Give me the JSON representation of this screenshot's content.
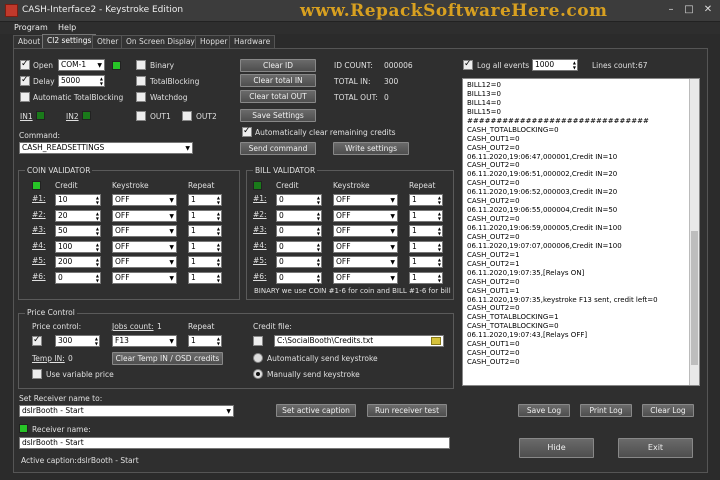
{
  "window": {
    "title": "CASH-Interface2 - Keystroke Edition",
    "watermark": "www.RepackSoftwareHere.com",
    "min": "–",
    "max": "□",
    "close": "✕"
  },
  "menu": [
    "Program",
    "Help"
  ],
  "tabs": [
    "About",
    "Cl2 settings",
    "Other",
    "On Screen Display",
    "Hopper",
    "Hardware"
  ],
  "top": {
    "open_label": "Open",
    "port": "COM-1",
    "delay_label": "Delay",
    "delay_value": "5000",
    "auto_totalblocking": "Automatic TotalBlocking",
    "binary": "Binary",
    "totalblocking": "TotalBlocking",
    "watchdog": "Watchdog",
    "in1": "IN1",
    "in2": "IN2",
    "out1": "OUT1",
    "out2": "OUT2",
    "clear_id": "Clear ID",
    "clear_total_in": "Clear total IN",
    "clear_total_out": "Clear total OUT",
    "save_settings": "Save Settings",
    "id_count_label": "ID COUNT:",
    "id_count": "000006",
    "total_in_label": "TOTAL IN:",
    "total_in": "300",
    "total_out_label": "TOTAL OUT:",
    "total_out": "0",
    "auto_clear": "Automatically clear remaining credits",
    "command_label": "Command:",
    "command_value": "CASH_READSETTINGS",
    "send_command": "Send command",
    "write_settings": "Write settings"
  },
  "coin": {
    "title": "COIN VALIDATOR",
    "headers": [
      "Credit",
      "Keystroke",
      "Repeat"
    ],
    "rows": [
      {
        "id": "#1:",
        "credit": "10",
        "key": "OFF",
        "repeat": "1"
      },
      {
        "id": "#2:",
        "credit": "20",
        "key": "OFF",
        "repeat": "1"
      },
      {
        "id": "#3:",
        "credit": "50",
        "key": "OFF",
        "repeat": "1"
      },
      {
        "id": "#4:",
        "credit": "100",
        "key": "OFF",
        "repeat": "1"
      },
      {
        "id": "#5:",
        "credit": "200",
        "key": "OFF",
        "repeat": "1"
      },
      {
        "id": "#6:",
        "credit": "0",
        "key": "OFF",
        "repeat": "1"
      }
    ]
  },
  "bill": {
    "title": "BILL VALIDATOR",
    "headers": [
      "Credit",
      "Keystroke",
      "Repeat"
    ],
    "rows": [
      {
        "id": "#1:",
        "credit": "0",
        "key": "OFF",
        "repeat": "1"
      },
      {
        "id": "#2:",
        "credit": "0",
        "key": "OFF",
        "repeat": "1"
      },
      {
        "id": "#3:",
        "credit": "0",
        "key": "OFF",
        "repeat": "1"
      },
      {
        "id": "#4:",
        "credit": "0",
        "key": "OFF",
        "repeat": "1"
      },
      {
        "id": "#5:",
        "credit": "0",
        "key": "OFF",
        "repeat": "1"
      },
      {
        "id": "#6:",
        "credit": "0",
        "key": "OFF",
        "repeat": "1"
      }
    ],
    "note": "BINARY we use COIN #1-6 for coin and BILL #1-6 for bill"
  },
  "price": {
    "title": "Price Control",
    "price_control_label": "Price control:",
    "price_value": "300",
    "jobs_count_label": "Jobs count:",
    "jobs_count": "1",
    "repeat_label": "Repeat",
    "keystroke": "F13",
    "repeat_value": "1",
    "temp_in_label": "Temp IN:",
    "temp_in": "0",
    "clear_temp": "Clear Temp IN / OSD credits",
    "use_variable_price": "Use variable price",
    "credit_file_label": "Credit file:",
    "credit_file": "C:\\SocialBooth\\Credits.txt",
    "auto_send": "Automatically send keystroke",
    "manual_send": "Manually send keystroke"
  },
  "log": {
    "log_all_label": "Log all events",
    "log_all_value": "1000",
    "lines_count_label": "Lines count:",
    "lines_count": "67",
    "lines": [
      "BILL12=0",
      "BILL13=0",
      "BILL14=0",
      "BILL15=0",
      "###############################",
      "CASH_TOTALBLOCKING=0",
      "CASH_OUT1=0",
      "CASH_OUT2=0",
      "06.11.2020,19:06:47,000001,Credit IN=10",
      "CASH_OUT2=0",
      "06.11.2020,19:06:51,000002,Credit IN=20",
      "CASH_OUT2=0",
      "06.11.2020,19:06:52,000003,Credit IN=20",
      "CASH_OUT2=0",
      "06.11.2020,19:06:55,000004,Credit IN=50",
      "CASH_OUT2=0",
      "06.11.2020,19:06:59,000005,Credit IN=100",
      "CASH_OUT2=0",
      "06.11.2020,19:07:07,000006,Credit IN=100",
      "CASH_OUT2=1",
      "CASH_OUT2=1",
      "06.11.2020,19:07:35,[Relays ON]",
      "CASH_OUT2=0",
      "CASH_OUT1=1",
      "06.11.2020,19:07:35,keystroke F13 sent, credit left=0",
      "CASH_OUT2=0",
      "CASH_TOTALBLOCKING=1",
      "CASH_TOTALBLOCKING=0",
      "06.11.2020,19:07:43,[Relays OFF]",
      "CASH_OUT1=0",
      "CASH_OUT2=0",
      "CASH_OUT2=0"
    ],
    "save_log": "Save Log",
    "print_log": "Print Log",
    "clear_log": "Clear Log"
  },
  "receiver": {
    "set_name_label": "Set Receiver name to:",
    "set_name_value": "dslrBooth - Start",
    "set_active_caption": "Set active caption",
    "run_receiver_test": "Run receiver test",
    "receiver_name_label": "Receiver name:",
    "receiver_name_value": "dslrBooth - Start",
    "active_caption_label": "Active caption:",
    "active_caption_value": "dslrBooth - Start"
  },
  "footer": {
    "hide": "Hide",
    "exit": "Exit"
  }
}
